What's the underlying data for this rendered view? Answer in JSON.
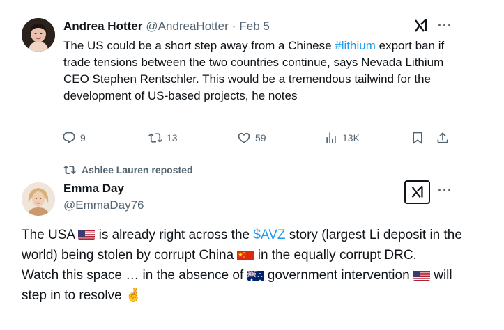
{
  "tweet1": {
    "author_name": "Andrea Hotter",
    "handle": "@AndreaHotter",
    "separator": "·",
    "date": "Feb 5",
    "text_before": "The US could be a short step away from a Chinese ",
    "hashtag": "#lithium",
    "text_after": " export ban if trade tensions between the two countries continue, says Nevada Lithium CEO Stephen Rentschler. This would be a tremendous tailwind for the development of US-based projects, he notes",
    "more_label": "···",
    "actions": {
      "replies": "9",
      "reposts": "13",
      "likes": "59",
      "views": "13K"
    }
  },
  "repost_banner": {
    "text": "Ashlee Lauren reposted"
  },
  "tweet2": {
    "author_name": "Emma Day",
    "handle": "@EmmaDay76",
    "more_label": "···",
    "text_1": "The USA ",
    "text_2": " is already right across the ",
    "cashtag": "$AVZ",
    "text_3": " story (largest Li deposit in the world) being stolen by corrupt China ",
    "text_4": " in the equally corrupt DRC.",
    "text_5": "Watch this space … in the absence of ",
    "text_6": " government intervention ",
    "text_7": " will step in to resolve ",
    "emoji_fingers": "🤞"
  },
  "icons": {
    "grok": "grok-icon",
    "reply": "reply-icon",
    "repost": "repost-icon",
    "like": "heart-icon",
    "views": "views-icon",
    "bookmark": "bookmark-icon",
    "share": "share-icon",
    "flag_us": "flag-us-icon",
    "flag_china": "flag-china-icon",
    "flag_australia": "flag-australia-icon"
  },
  "colors": {
    "link": "#1d9bf0",
    "muted": "#536471",
    "text": "#0f1419"
  }
}
